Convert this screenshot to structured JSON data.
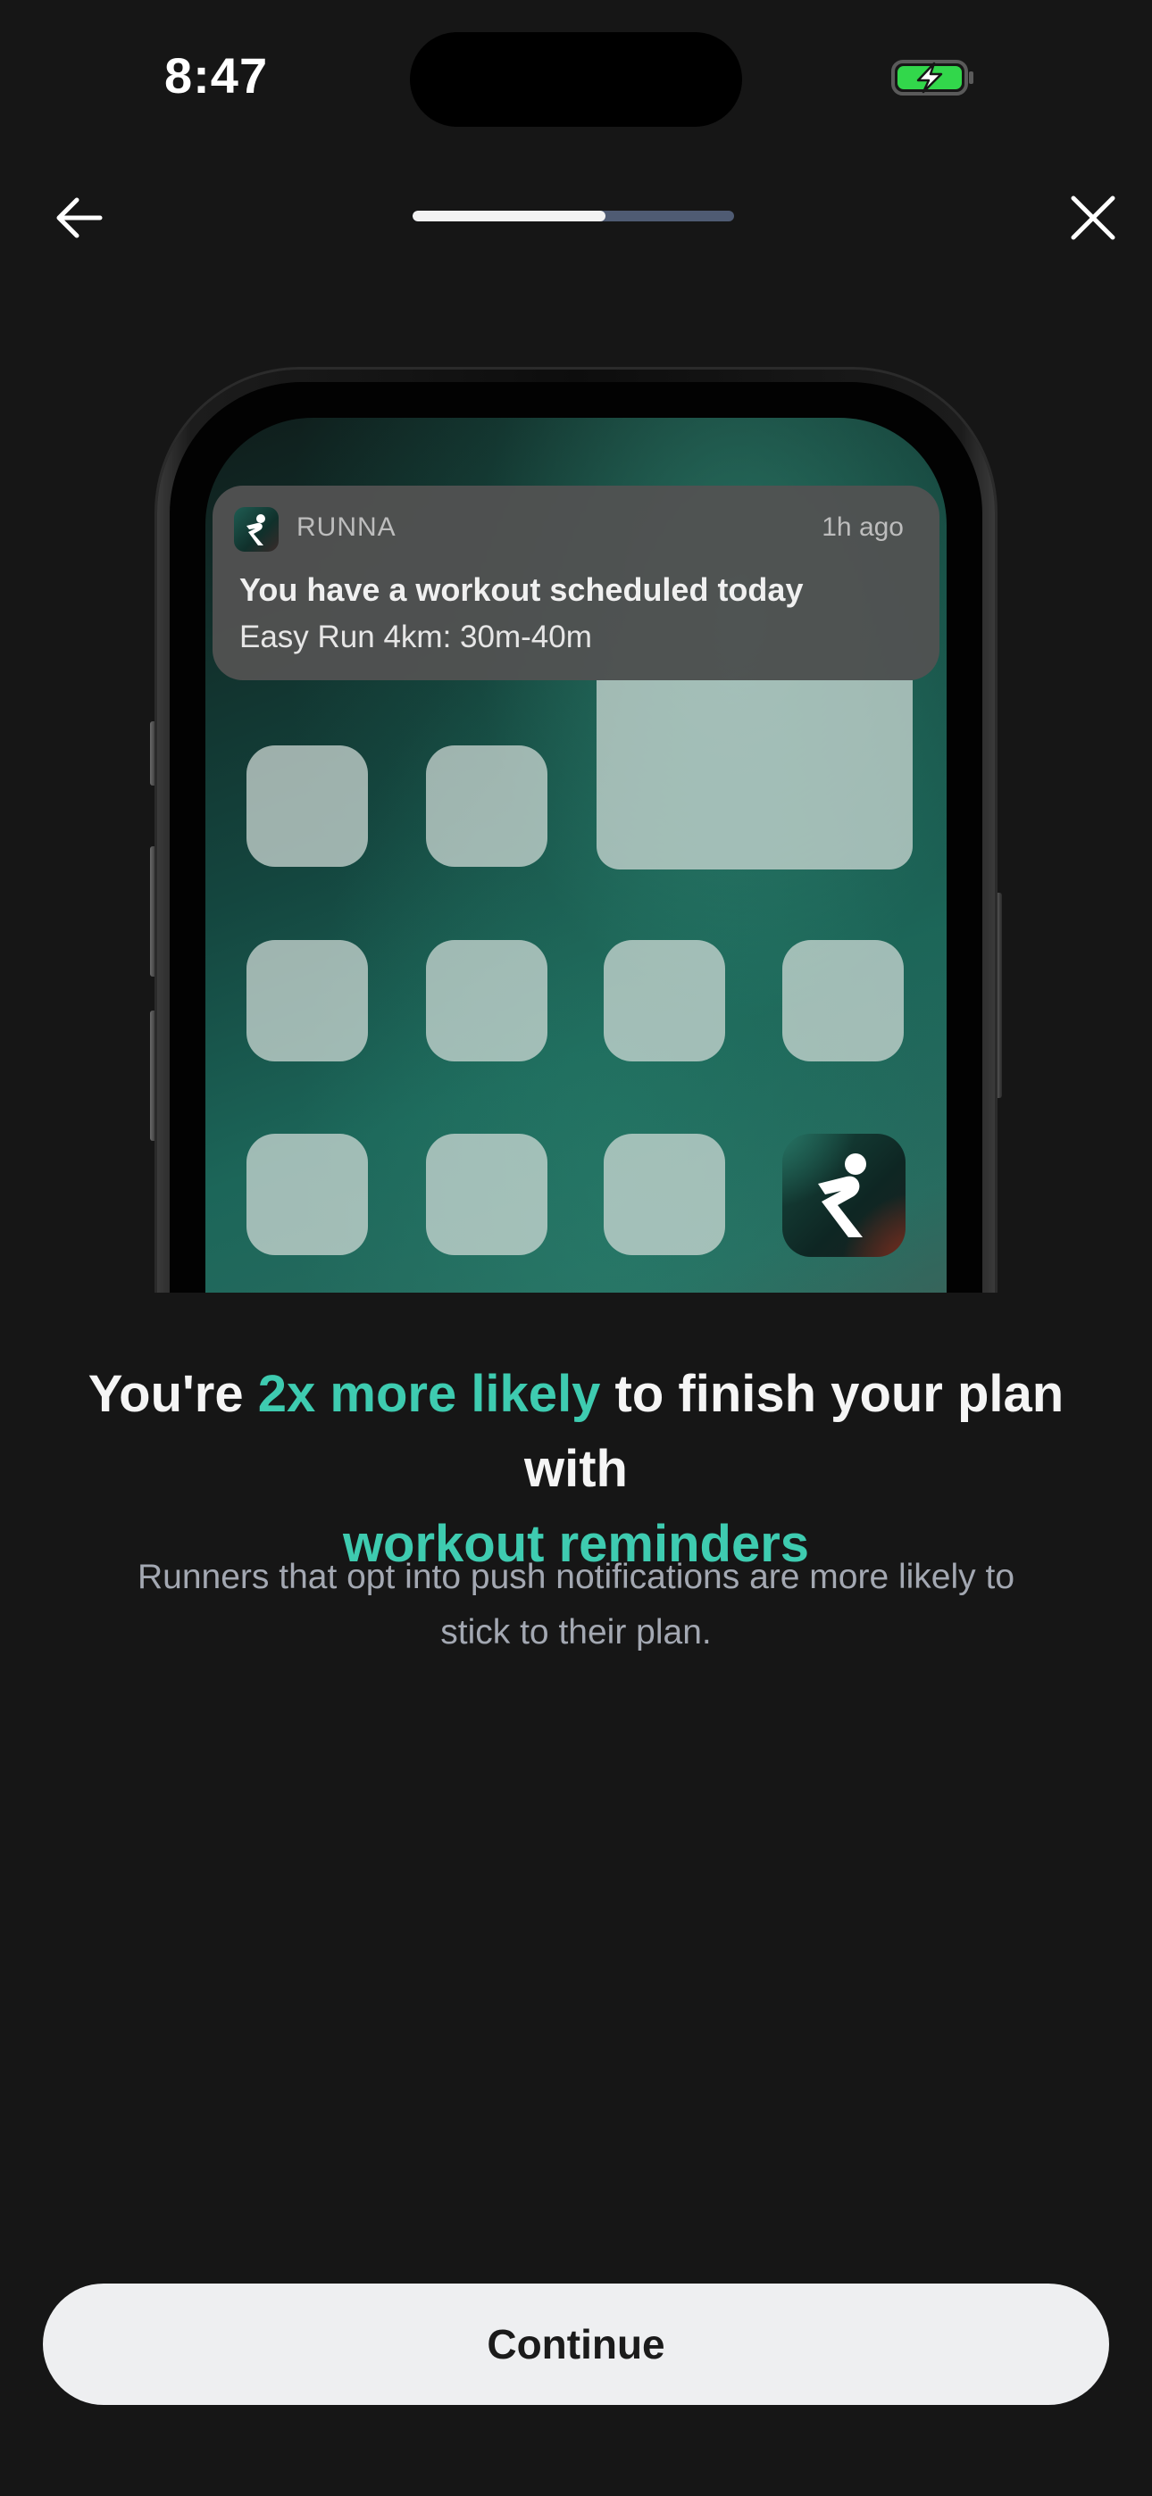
{
  "status_bar": {
    "time": "8:47",
    "battery_icon": "battery-charging-icon",
    "battery_color": "#32d74b"
  },
  "nav": {
    "back_icon": "arrow-left-icon",
    "close_icon": "close-icon",
    "progress_fraction": 0.6
  },
  "illustration": {
    "notification": {
      "app_name": "RUNNA",
      "time_ago": "1h ago",
      "title": "You have a workout scheduled today",
      "body": "Easy Run 4km: 30m-40m",
      "app_icon": "runna-logo-icon"
    },
    "home_screen_app_icon": "runna-logo-icon"
  },
  "headline": {
    "part1": "You're ",
    "accent1": "2x more likely",
    "part2": " to finish your plan with ",
    "accent2": "workout reminders",
    "accent_color": "#3ecbb0"
  },
  "subcopy": "Runners that opt into push notifications are more likely to stick to their plan.",
  "cta": {
    "label": "Continue"
  }
}
